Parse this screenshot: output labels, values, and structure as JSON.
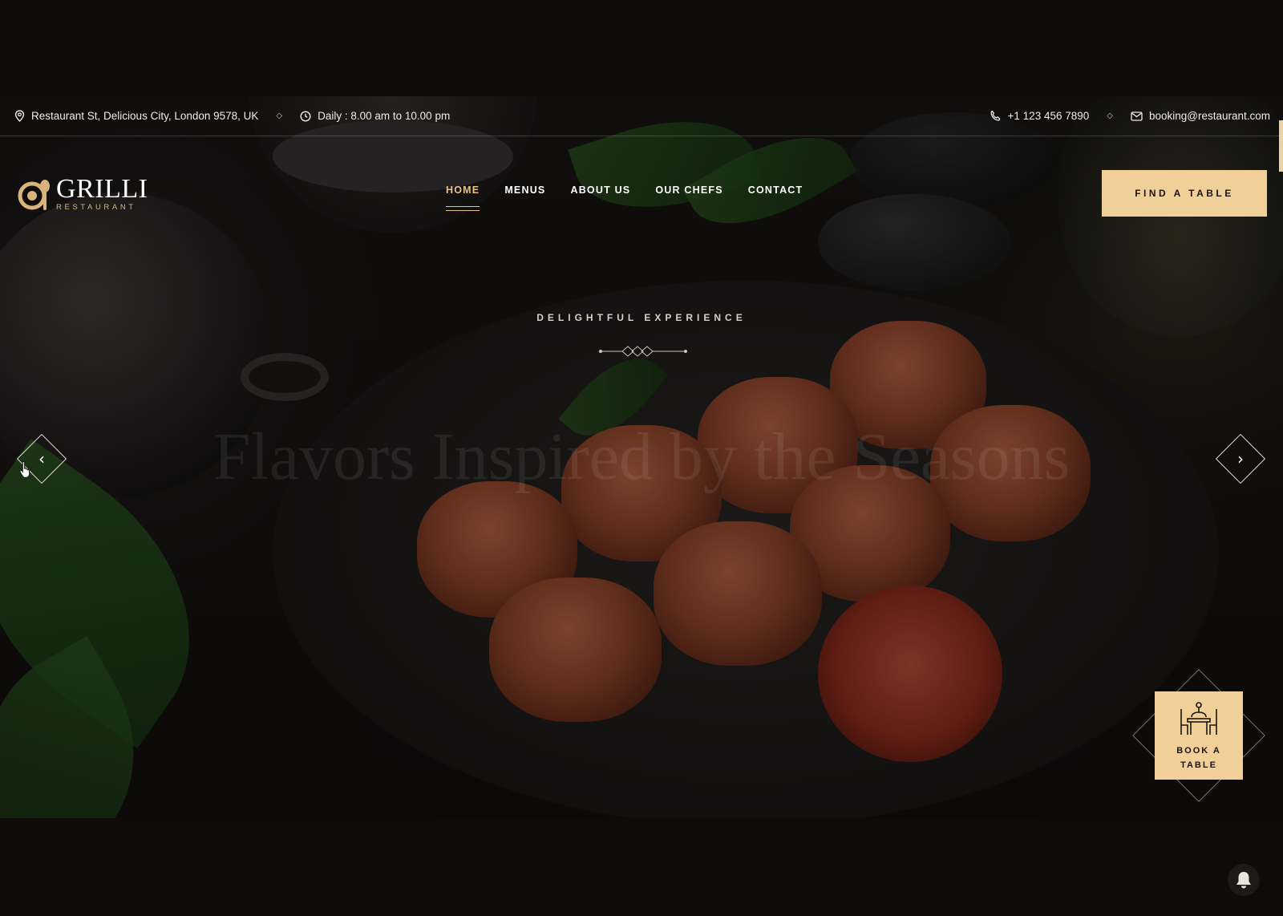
{
  "topbar": {
    "address": "Restaurant St, Delicious City, London 9578, UK",
    "hours": "Daily : 8.00 am to 10.00 pm",
    "phone": "+1 123 456 7890",
    "email": "booking@restaurant.com",
    "separator": "◇"
  },
  "brand": {
    "name": "GRILLI",
    "tagline": "RESTAURANT",
    "accent_color": "#f0cf98",
    "logo_icon": "plate-and-spoon-icon"
  },
  "nav": {
    "items": [
      {
        "label": "HOME",
        "active": true
      },
      {
        "label": "MENUS",
        "active": false
      },
      {
        "label": "ABOUT US",
        "active": false
      },
      {
        "label": "OUR CHEFS",
        "active": false
      },
      {
        "label": "CONTACT",
        "active": false
      }
    ],
    "cta_label": "FIND A TABLE"
  },
  "hero": {
    "kicker": "DELIGHTFUL EXPERIENCE",
    "headline": "Flavors Inspired by the Seasons",
    "prev_icon": "chevron-left-icon",
    "next_icon": "chevron-right-icon",
    "prev_glyph": "‹",
    "next_glyph": "›"
  },
  "book_table": {
    "line1": "BOOK A",
    "line2": "TABLE",
    "icon": "dining-table-icon"
  },
  "notification_icon": "bell-icon"
}
